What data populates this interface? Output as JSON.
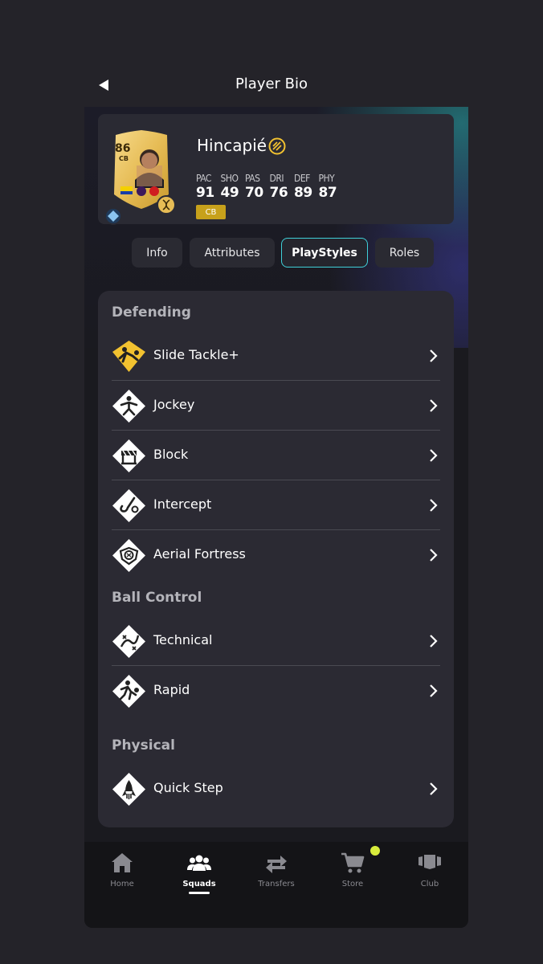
{
  "header": {
    "title": "Player Bio",
    "back_icon": "back-arrow-icon"
  },
  "player": {
    "name": "Hincapié",
    "rating": "86",
    "card_position": "CB",
    "position_badge": "CB",
    "stats": [
      {
        "label": "PAC",
        "value": "91"
      },
      {
        "label": "SHO",
        "value": "49"
      },
      {
        "label": "PAS",
        "value": "70"
      },
      {
        "label": "DRI",
        "value": "76"
      },
      {
        "label": "DEF",
        "value": "89"
      },
      {
        "label": "PHY",
        "value": "87"
      }
    ],
    "colors": {
      "card_gold": "#e6bc55",
      "position_badge": "#c7a11b"
    }
  },
  "tabs": [
    {
      "label": "Info",
      "active": false
    },
    {
      "label": "Attributes",
      "active": false
    },
    {
      "label": "PlayStyles",
      "active": true
    },
    {
      "label": "Roles",
      "active": false
    }
  ],
  "sections": [
    {
      "title": "Defending"
    },
    {
      "title": "Ball Control"
    },
    {
      "title": "Physical"
    }
  ],
  "playstyles": [
    {
      "label": "Slide Tackle+",
      "icon": "slide-tackle-plus-icon",
      "plus": true
    },
    {
      "label": "Jockey",
      "icon": "jockey-icon",
      "plus": false
    },
    {
      "label": "Block",
      "icon": "block-icon",
      "plus": false
    },
    {
      "label": "Intercept",
      "icon": "intercept-icon",
      "plus": false
    },
    {
      "label": "Aerial Fortress",
      "icon": "aerial-fortress-icon",
      "plus": false
    },
    {
      "label": "Technical",
      "icon": "technical-icon",
      "plus": false
    },
    {
      "label": "Rapid",
      "icon": "rapid-icon",
      "plus": false
    },
    {
      "label": "Quick Step",
      "icon": "quick-step-icon",
      "plus": false
    }
  ],
  "bottom_nav": [
    {
      "label": "Home",
      "icon": "home-icon",
      "active": false
    },
    {
      "label": "Squads",
      "icon": "squads-icon",
      "active": true
    },
    {
      "label": "Transfers",
      "icon": "transfers-icon",
      "active": false
    },
    {
      "label": "Store",
      "icon": "store-cart-icon",
      "active": false,
      "notification": true
    },
    {
      "label": "Club",
      "icon": "club-icon",
      "active": false
    }
  ],
  "colors": {
    "accent_tab_border": "#3fd0d8",
    "plus_icon": "#f2c230",
    "notification_dot": "#d8ec3c"
  }
}
